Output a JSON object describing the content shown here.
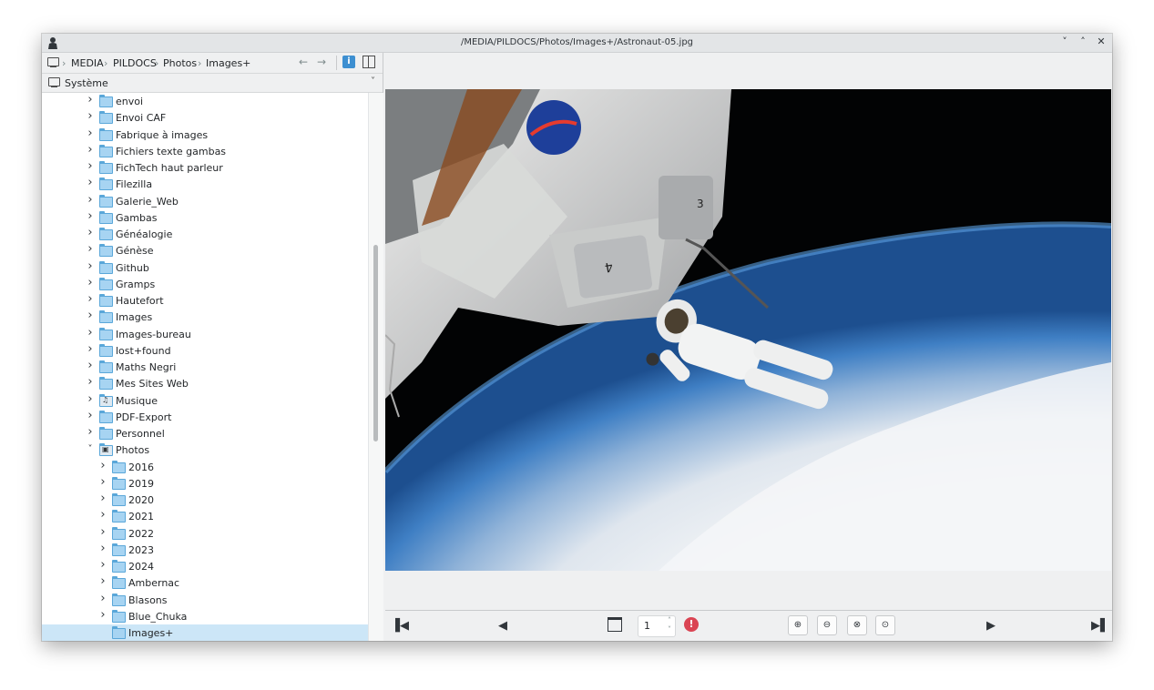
{
  "window": {
    "title": "/MEDIA/PILDOCS/Photos/Images+/Astronaut-05.jpg",
    "controls": [
      "˅",
      "˄",
      "✕"
    ]
  },
  "breadcrumb": {
    "items": [
      "MEDIA",
      "PILDOCS",
      "Photos",
      "Images+"
    ],
    "back": "←",
    "forward": "→",
    "info_label": "i"
  },
  "places": {
    "selected": "Système"
  },
  "tree": {
    "items": [
      {
        "name": "envoi",
        "expanded": false,
        "level": 0
      },
      {
        "name": "Envoi CAF",
        "expanded": false,
        "level": 0
      },
      {
        "name": "Fabrique à images",
        "expanded": false,
        "level": 0
      },
      {
        "name": "Fichiers texte gambas",
        "expanded": false,
        "level": 0
      },
      {
        "name": "FichTech haut parleur",
        "expanded": false,
        "level": 0
      },
      {
        "name": "Filezilla",
        "expanded": false,
        "level": 0
      },
      {
        "name": "Galerie_Web",
        "expanded": false,
        "level": 0
      },
      {
        "name": "Gambas",
        "expanded": false,
        "level": 0
      },
      {
        "name": "Généalogie",
        "expanded": false,
        "level": 0
      },
      {
        "name": "Génèse",
        "expanded": false,
        "level": 0
      },
      {
        "name": "Github",
        "expanded": false,
        "level": 0
      },
      {
        "name": "Gramps",
        "expanded": false,
        "level": 0
      },
      {
        "name": "Hautefort",
        "expanded": false,
        "level": 0
      },
      {
        "name": "Images",
        "expanded": false,
        "level": 0
      },
      {
        "name": "Images-bureau",
        "expanded": false,
        "level": 0
      },
      {
        "name": "lost+found",
        "expanded": false,
        "level": 0
      },
      {
        "name": "Maths Negri",
        "expanded": false,
        "level": 0
      },
      {
        "name": "Mes Sites Web",
        "expanded": false,
        "level": 0
      },
      {
        "name": "Musique",
        "expanded": false,
        "level": 0,
        "icon": "music-folder-icon"
      },
      {
        "name": "PDF-Export",
        "expanded": false,
        "level": 0
      },
      {
        "name": "Personnel",
        "expanded": false,
        "level": 0
      },
      {
        "name": "Photos",
        "expanded": true,
        "level": 0,
        "icon": "pictures-folder-icon"
      },
      {
        "name": "2016",
        "expanded": false,
        "level": 1
      },
      {
        "name": "2019",
        "expanded": false,
        "level": 1
      },
      {
        "name": "2020",
        "expanded": false,
        "level": 1
      },
      {
        "name": "2021",
        "expanded": false,
        "level": 1
      },
      {
        "name": "2022",
        "expanded": false,
        "level": 1
      },
      {
        "name": "2023",
        "expanded": false,
        "level": 1
      },
      {
        "name": "2024",
        "expanded": false,
        "level": 1
      },
      {
        "name": "Ambernac",
        "expanded": false,
        "level": 1
      },
      {
        "name": "Blasons",
        "expanded": false,
        "level": 1
      },
      {
        "name": "Blue_Chuka",
        "expanded": false,
        "level": 1
      },
      {
        "name": "Images+",
        "expanded": null,
        "level": 1,
        "selected": true
      }
    ]
  },
  "viewer": {
    "image_description_icon": "astronaut-photo",
    "frame_value": "1"
  },
  "toolbar": {
    "first": "first-icon",
    "prev": "prev-icon",
    "next": "next-icon",
    "last": "last-icon",
    "zoom_in": "zoom-in-icon",
    "zoom_out": "zoom-out-icon",
    "zoom_fit": "zoom-fit-icon",
    "zoom_orig": "zoom-original-icon"
  },
  "colors": {
    "selection": "#cce6f7",
    "folder": "#a7d4f2",
    "stop": "#da4453",
    "accent": "#3d8fd1"
  }
}
